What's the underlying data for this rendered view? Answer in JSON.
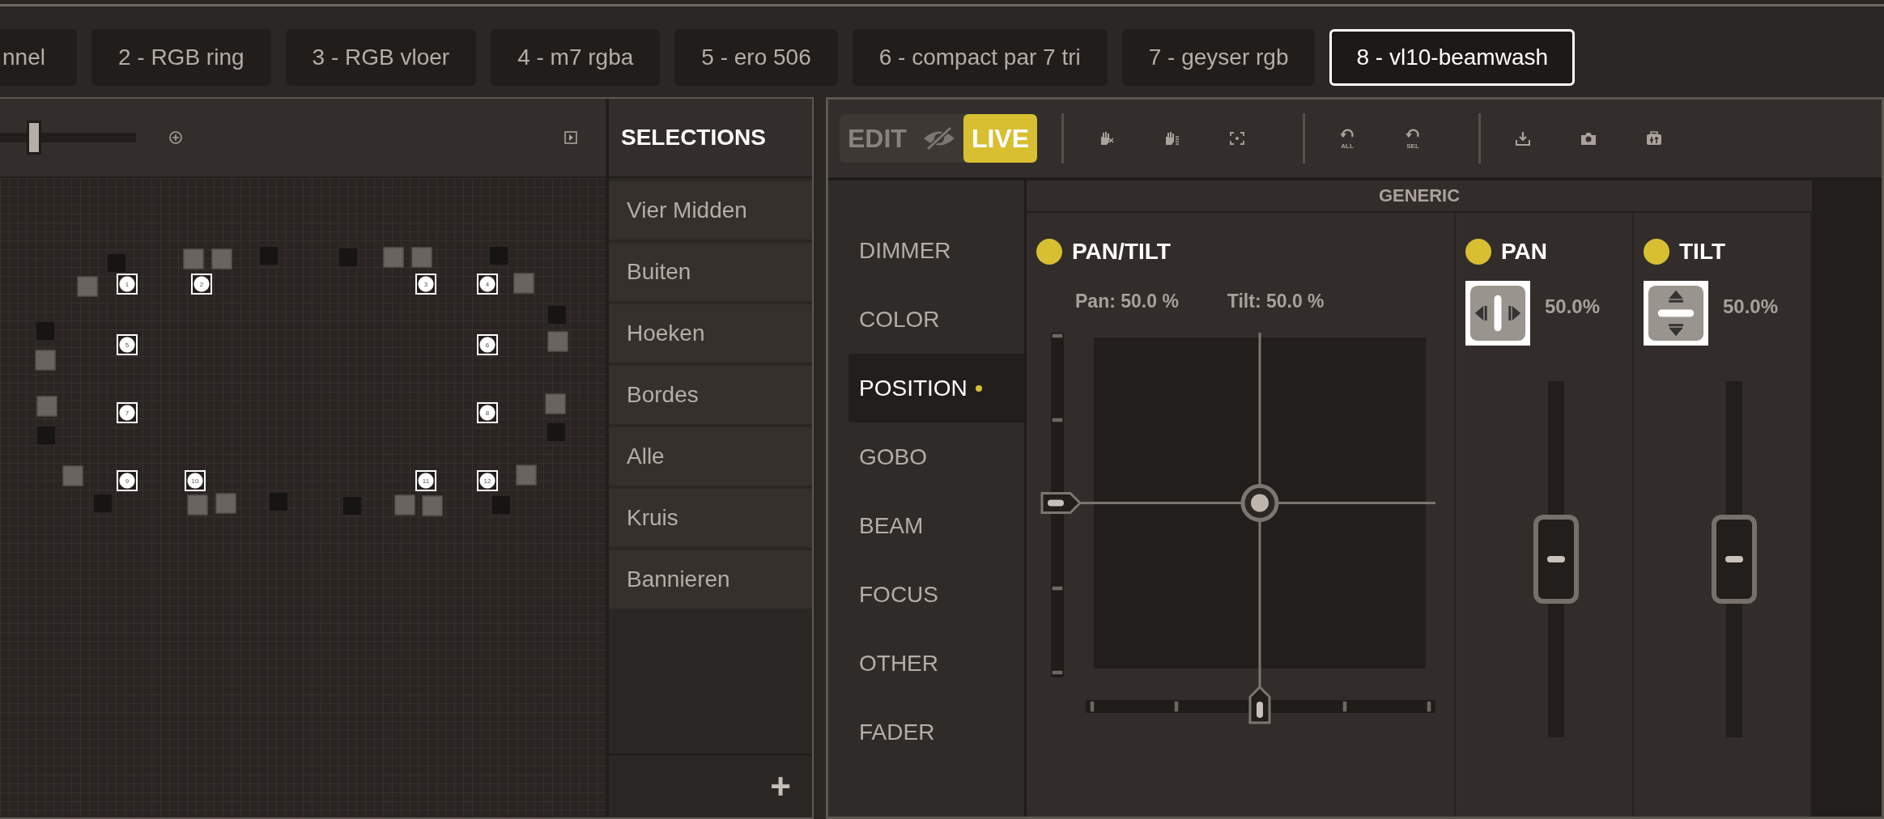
{
  "tabs": [
    {
      "label": "nnel",
      "selected": false
    },
    {
      "label": "2 - RGB ring",
      "selected": false
    },
    {
      "label": "3 - RGB vloer",
      "selected": false
    },
    {
      "label": "4 - m7 rgba",
      "selected": false
    },
    {
      "label": "5 - ero 506",
      "selected": false
    },
    {
      "label": "6 - compact par 7 tri",
      "selected": false
    },
    {
      "label": "7 - geyser rgb",
      "selected": false
    },
    {
      "label": "8 - vl10-beamwash",
      "selected": true
    }
  ],
  "layout_toolbar": {
    "zoom": {
      "level": 0.25
    }
  },
  "fixtures": [
    {
      "label": "1",
      "selected": true
    },
    {
      "label": "2",
      "selected": true
    },
    {
      "label": "3",
      "selected": true
    },
    {
      "label": "4",
      "selected": true
    },
    {
      "label": "5",
      "selected": true
    },
    {
      "label": "6",
      "selected": true
    },
    {
      "label": "7",
      "selected": true
    },
    {
      "label": "8",
      "selected": true
    },
    {
      "label": "9",
      "selected": true
    },
    {
      "label": "10",
      "selected": true
    },
    {
      "label": "11",
      "selected": true
    },
    {
      "label": "12",
      "selected": true
    }
  ],
  "selections": {
    "title": "SELECTIONS",
    "items": [
      "Vier Midden",
      "Buiten",
      "Hoeken",
      "Bordes",
      "Alle",
      "Kruis",
      "Bannieren"
    ],
    "add_button": "+"
  },
  "programmer": {
    "modes": [
      {
        "label": "EDIT",
        "selected": false
      },
      {
        "label": "LIVE",
        "selected": true
      }
    ],
    "toolbar": [
      {
        "kind": "hand-x"
      },
      {
        "kind": "hand-stack"
      },
      {
        "kind": "focus-frame"
      },
      {
        "kind": "undo",
        "caption": "ALL"
      },
      {
        "kind": "undo",
        "caption": "SEL"
      },
      {
        "kind": "download"
      },
      {
        "kind": "camera"
      },
      {
        "kind": "fixture"
      }
    ]
  },
  "features": [
    {
      "label": "DIMMER",
      "selected": false,
      "modified": false
    },
    {
      "label": "COLOR",
      "selected": false,
      "modified": false
    },
    {
      "label": "POSITION",
      "selected": true,
      "modified": true
    },
    {
      "label": "GOBO",
      "selected": false,
      "modified": false
    },
    {
      "label": "BEAM",
      "selected": false,
      "modified": false
    },
    {
      "label": "FOCUS",
      "selected": false,
      "modified": false
    },
    {
      "label": "OTHER",
      "selected": false,
      "modified": false
    },
    {
      "label": "FADER",
      "selected": false,
      "modified": false
    }
  ],
  "generic": {
    "title": "GENERIC",
    "pan_tilt": {
      "title": "PAN/TILT",
      "enabled": true,
      "pan": {
        "reading": "Pan: 50.0 %",
        "level": 0.5
      },
      "tilt": {
        "reading": "Tilt: 50.0 %",
        "level": 0.5
      }
    },
    "channels": [
      {
        "kind": "pan",
        "title": "PAN",
        "enabled": true,
        "reading": "50.0%",
        "level": 0.5
      },
      {
        "kind": "tilt",
        "title": "TILT",
        "enabled": true,
        "reading": "50.0%",
        "level": 0.5
      }
    ]
  }
}
